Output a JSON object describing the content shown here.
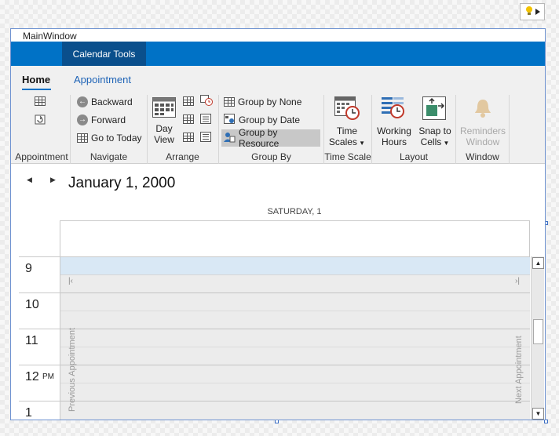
{
  "window": {
    "title": "MainWindow"
  },
  "ribbon": {
    "context_tab": "Calendar Tools",
    "tabs": [
      {
        "label": "Home",
        "active": true
      },
      {
        "label": "Appointment",
        "active": false
      }
    ],
    "groups": {
      "appointment": {
        "label": "Appointment",
        "icons": [
          "new-appointment-icon",
          "new-recurring-appointment-icon"
        ]
      },
      "navigate": {
        "label": "Navigate",
        "buttons": [
          {
            "label": "Backward",
            "icon": "arrow-left-circle-icon"
          },
          {
            "label": "Forward",
            "icon": "arrow-right-circle-icon"
          },
          {
            "label": "Go to Today",
            "icon": "calendar-today-icon"
          }
        ]
      },
      "arrange": {
        "label": "Arrange",
        "day_view": "Day\nView",
        "small_icons": [
          "work-week-view-icon",
          "timeline-view-icon",
          "week-view-icon",
          "list-view-icon",
          "month-view-icon",
          "agenda-view-icon"
        ]
      },
      "group_by": {
        "label": "Group By",
        "buttons": [
          {
            "label": "Group by None",
            "icon": "group-none-icon",
            "selected": false
          },
          {
            "label": "Group by Date",
            "icon": "group-date-icon",
            "selected": false
          },
          {
            "label": "Group by Resource",
            "icon": "group-resource-icon",
            "selected": true
          }
        ]
      },
      "time_scale": {
        "label": "Time Scale",
        "button_line1": "Time",
        "button_line2": "Scales"
      },
      "layout": {
        "label": "Layout",
        "working_hours_line1": "Working",
        "working_hours_line2": "Hours",
        "snap_line1": "Snap to",
        "snap_line2": "Cells"
      },
      "window": {
        "label": "Window",
        "reminders_line1": "Reminders",
        "reminders_line2": "Window"
      }
    }
  },
  "scheduler": {
    "date_title": "January 1, 2000",
    "day_header": "SATURDAY, 1",
    "hours": [
      {
        "num": "9",
        "ampm": ""
      },
      {
        "num": "10",
        "ampm": ""
      },
      {
        "num": "11",
        "ampm": ""
      },
      {
        "num": "12",
        "ampm": "PM"
      },
      {
        "num": "1",
        "ampm": ""
      }
    ],
    "prev_appointment": "Previous Appointment",
    "next_appointment": "Next Appointment"
  },
  "colors": {
    "accent": "#0072c6",
    "context_tab": "#0a4f8c",
    "selected_cell": "#d9e8f5"
  }
}
